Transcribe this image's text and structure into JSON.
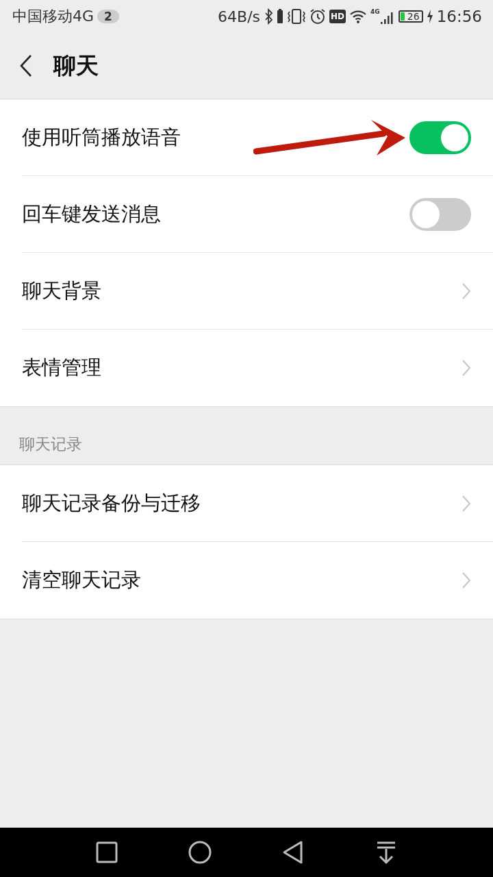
{
  "status_bar": {
    "carrier": "中国移动4G",
    "sim_badge": "2",
    "speed": "64B/s",
    "hd_badge": "HD",
    "network_type": "4G",
    "battery": "26",
    "time": "16:56"
  },
  "header": {
    "title": "聊天"
  },
  "sections": [
    {
      "items": [
        {
          "label": "使用听筒播放语音",
          "kind": "toggle",
          "on": true,
          "annotated": true
        },
        {
          "label": "回车键发送消息",
          "kind": "toggle",
          "on": false
        },
        {
          "label": "聊天背景",
          "kind": "link"
        },
        {
          "label": "表情管理",
          "kind": "link"
        }
      ]
    },
    {
      "title": "聊天记录",
      "items": [
        {
          "label": "聊天记录备份与迁移",
          "kind": "link"
        },
        {
          "label": "清空聊天记录",
          "kind": "link"
        }
      ]
    }
  ]
}
